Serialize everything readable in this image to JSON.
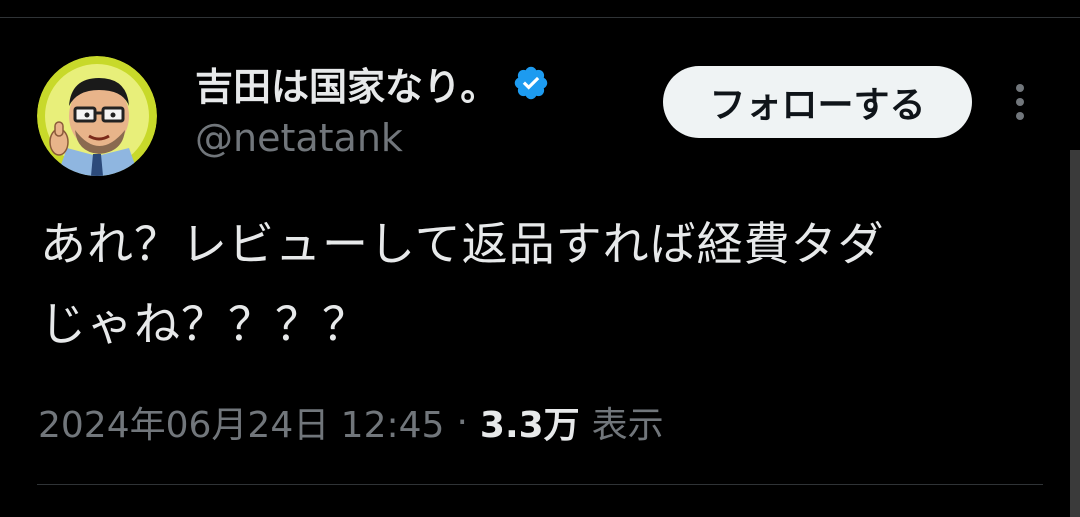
{
  "author": {
    "display_name": "吉田は国家なり。",
    "handle": "@netatank",
    "verified_icon": "verified-badge-icon",
    "avatar_icon": "cartoon-avatar"
  },
  "actions": {
    "follow_label": "フォローする",
    "more_icon": "more-vertical-icon"
  },
  "tweet": {
    "line1": "あれ？レビューして返品すれば経費タダ",
    "line2": "じゃね？？？？"
  },
  "meta": {
    "timestamp": "2024年06月24日 12:45",
    "separator": "·",
    "views_count": "3.3万",
    "views_label": "表示"
  },
  "colors": {
    "background": "#000000",
    "text": "#e7e9ea",
    "secondary": "#71767b",
    "verified": "#1d9bf0",
    "button_bg": "#eff3f4",
    "divider": "#2f3336"
  }
}
